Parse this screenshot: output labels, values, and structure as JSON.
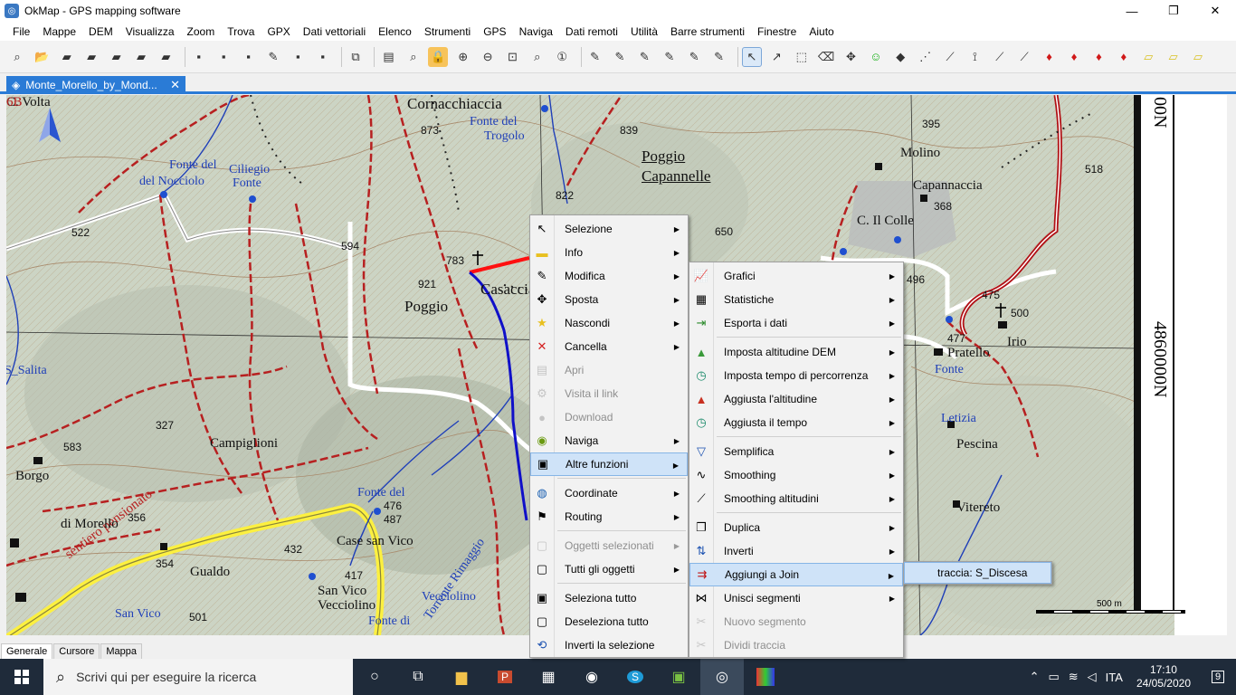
{
  "window": {
    "title": "OkMap - GPS mapping software",
    "controls": [
      "—",
      "❐",
      "✕"
    ]
  },
  "menubar": [
    "File",
    "Mappe",
    "DEM",
    "Visualizza",
    "Zoom",
    "Trova",
    "GPX",
    "Dati vettoriali",
    "Elenco",
    "Strumenti",
    "GPS",
    "Naviga",
    "Dati remoti",
    "Utilità",
    "Barre strumenti",
    "Finestre",
    "Aiuto"
  ],
  "doc_tab": {
    "label": "Monte_Morello_by_Mond...",
    "close": "✕"
  },
  "map": {
    "labels": [
      {
        "text": "Cornacchiaccia",
        "cls": "big"
      },
      {
        "text": "Fonte del",
        "cls": "blue"
      },
      {
        "text": "Trogolo",
        "cls": "blue"
      },
      {
        "text": "873",
        "cls": "sm"
      },
      {
        "text": "839",
        "cls": "sm"
      },
      {
        "text": "Poggio",
        "cls": "big ul"
      },
      {
        "text": "Capannelle",
        "cls": "big ul"
      },
      {
        "text": "822",
        "cls": "sm"
      },
      {
        "text": "650",
        "cls": "sm"
      },
      {
        "text": "Fonte del",
        "cls": "blue"
      },
      {
        "text": "Ciliegio",
        "cls": "blue"
      },
      {
        "text": "Fonte",
        "cls": "blue"
      },
      {
        "text": "del Nocciolo",
        "cls": "blue"
      },
      {
        "text": "522",
        "cls": "sm"
      },
      {
        "text": "594",
        "cls": "sm"
      },
      {
        "text": "783",
        "cls": "sm"
      },
      {
        "text": "921",
        "cls": "sm"
      },
      {
        "text": "Poggio",
        "cls": "big"
      },
      {
        "text": "Casaccia",
        "cls": "big"
      },
      {
        "text": "S_Salita",
        "cls": "blue"
      },
      {
        "text": "327",
        "cls": "sm"
      },
      {
        "text": "Campiglioni",
        "cls": "med"
      },
      {
        "text": "583",
        "cls": "sm"
      },
      {
        "text": "sentiero pensionato",
        "cls": "red"
      },
      {
        "text": "Borgo",
        "cls": "med"
      },
      {
        "text": "di Morello",
        "cls": "med"
      },
      {
        "text": "356",
        "cls": "sm"
      },
      {
        "text": "354",
        "cls": "sm"
      },
      {
        "text": "Gualdo",
        "cls": "med"
      },
      {
        "text": "432",
        "cls": "sm"
      },
      {
        "text": "Case san Vico",
        "cls": "med"
      },
      {
        "text": "417",
        "cls": "sm"
      },
      {
        "text": "476",
        "cls": "sm"
      },
      {
        "text": "487",
        "cls": "sm"
      },
      {
        "text": "Fonte del",
        "cls": "blue"
      },
      {
        "text": "Vecciolino",
        "cls": "blue"
      },
      {
        "text": "Torrente Rimaggio",
        "cls": "blue"
      },
      {
        "text": "San Vico",
        "cls": "med"
      },
      {
        "text": "Vecciolino",
        "cls": "med"
      },
      {
        "text": "Fonte di",
        "cls": "blue"
      },
      {
        "text": "San Vico",
        "cls": "blue"
      },
      {
        "text": "501",
        "cls": "sm"
      },
      {
        "text": "395",
        "cls": "sm"
      },
      {
        "text": "Molino",
        "cls": "med"
      },
      {
        "text": "518",
        "cls": "sm"
      },
      {
        "text": "Capannaccia",
        "cls": "med"
      },
      {
        "text": "368",
        "cls": "sm"
      },
      {
        "text": "C. Il Colle",
        "cls": "med"
      },
      {
        "text": "496",
        "cls": "sm"
      },
      {
        "text": "500",
        "cls": "sm"
      },
      {
        "text": "Irio",
        "cls": "med"
      },
      {
        "text": "477",
        "cls": "sm"
      },
      {
        "text": "Pratello",
        "cls": "med"
      },
      {
        "text": "Fonte",
        "cls": "blue"
      },
      {
        "text": "Letizia",
        "cls": "blue"
      },
      {
        "text": "Pescina",
        "cls": "med"
      },
      {
        "text": "Vitereto",
        "cls": "med"
      },
      {
        "text": "475",
        "cls": "sm"
      },
      {
        "text": "C. Volta",
        "cls": "med"
      },
      {
        "text": "6B",
        "cls": "red"
      }
    ],
    "ruler_coord": "4860000N",
    "ruler_coord_top": "00N",
    "scale_label": "500 m"
  },
  "menu_main": [
    {
      "label": "Selezione",
      "icon": "↖",
      "arrow": true
    },
    {
      "label": "Info",
      "icon": "▬",
      "arrow": true
    },
    {
      "label": "Modifica",
      "icon": "✎",
      "arrow": true
    },
    {
      "label": "Sposta",
      "icon": "✥",
      "arrow": true
    },
    {
      "label": "Nascondi",
      "icon": "★",
      "arrow": true
    },
    {
      "label": "Cancella",
      "icon": "✕",
      "arrow": true
    },
    {
      "label": "Apri",
      "icon": "▤",
      "disabled": true
    },
    {
      "label": "Visita il link",
      "icon": "⚙",
      "disabled": true
    },
    {
      "label": "Download",
      "icon": "●",
      "disabled": true
    },
    {
      "label": "Naviga",
      "icon": "◉",
      "arrow": true
    },
    {
      "label": "Altre funzioni",
      "icon": "▣",
      "arrow": true,
      "highlight": true
    },
    {
      "sep": true
    },
    {
      "label": "Coordinate",
      "icon": "◍",
      "arrow": true
    },
    {
      "label": "Routing",
      "icon": "⚑",
      "arrow": true
    },
    {
      "sep": true
    },
    {
      "label": "Oggetti selezionati",
      "icon": "▢",
      "arrow": true,
      "disabled": true
    },
    {
      "label": "Tutti gli oggetti",
      "icon": "▢",
      "arrow": true
    },
    {
      "sep": true
    },
    {
      "label": "Seleziona tutto",
      "icon": "▣"
    },
    {
      "label": "Deseleziona tutto",
      "icon": "▢"
    },
    {
      "label": "Inverti la selezione",
      "icon": "⟲"
    }
  ],
  "menu_sub": [
    {
      "label": "Grafici",
      "icon": "📈",
      "arrow": true
    },
    {
      "label": "Statistiche",
      "icon": "▦",
      "arrow": true
    },
    {
      "label": "Esporta i dati",
      "icon": "⇥",
      "arrow": true
    },
    {
      "sep": true
    },
    {
      "label": "Imposta altitudine DEM",
      "icon": "▲",
      "arrow": true
    },
    {
      "label": "Imposta tempo di percorrenza",
      "icon": "◷",
      "arrow": true
    },
    {
      "label": "Aggiusta l'altitudine",
      "icon": "▲",
      "arrow": true
    },
    {
      "label": "Aggiusta il tempo",
      "icon": "◷",
      "arrow": true
    },
    {
      "sep": true
    },
    {
      "label": "Semplifica",
      "icon": "▽",
      "arrow": true
    },
    {
      "label": "Smoothing",
      "icon": "∿",
      "arrow": true
    },
    {
      "label": "Smoothing altitudini",
      "icon": "⟋",
      "arrow": true
    },
    {
      "sep": true
    },
    {
      "label": "Duplica",
      "icon": "❐",
      "arrow": true
    },
    {
      "label": "Inverti",
      "icon": "⇅",
      "arrow": true
    },
    {
      "label": "Aggiungi a Join",
      "icon": "⇉",
      "arrow": true,
      "highlight": true
    },
    {
      "label": "Unisci segmenti",
      "icon": "⋈",
      "arrow": true
    },
    {
      "label": "Nuovo segmento",
      "icon": "✂",
      "disabled": true
    },
    {
      "label": "Dividi traccia",
      "icon": "✂",
      "disabled": true
    }
  ],
  "menu_join": [
    {
      "label": "traccia: S_Discesa",
      "highlight": true
    }
  ],
  "bottom_tabs": [
    "Generale",
    "Cursore",
    "Mappa"
  ],
  "taskbar": {
    "search_placeholder": "Scrivi qui per eseguire la ricerca",
    "language": "ITA",
    "time": "17:10",
    "date": "24/05/2020",
    "notifications": "9"
  },
  "colors": {
    "accent": "#2a7bd6",
    "menu_bg": "#f2f2f2",
    "menu_highlight": "#cfe3f8",
    "taskbar": "#1f2b3a",
    "map_bg": "#cfd6c8",
    "trail_red": "#b72020",
    "track_blue": "#1010c8"
  }
}
